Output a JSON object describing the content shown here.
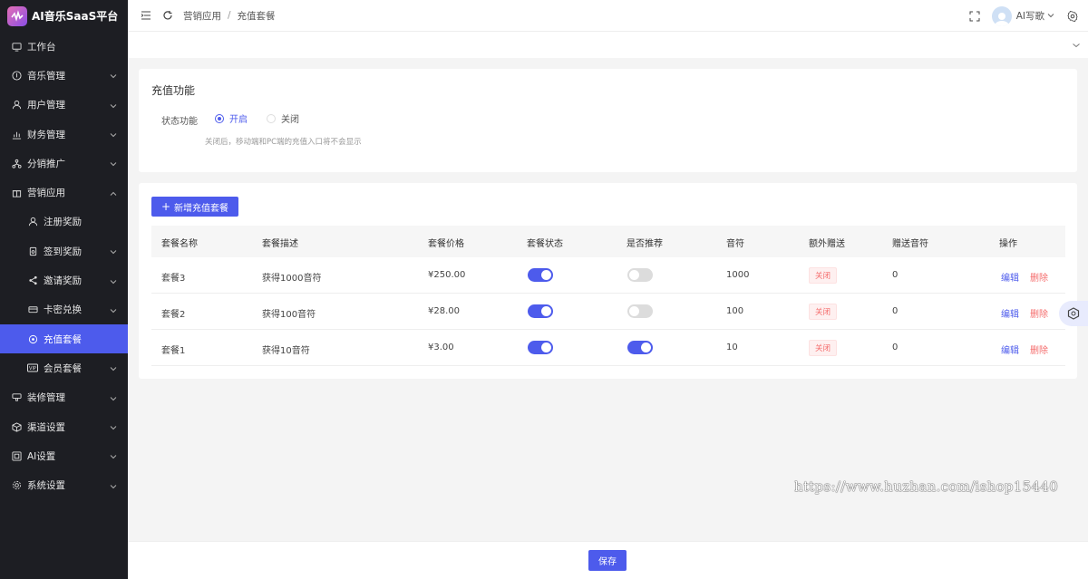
{
  "app": {
    "title": "AI音乐SaaS平台"
  },
  "sidebar": {
    "items": [
      {
        "label": "工作台",
        "icon": "monitor-icon"
      },
      {
        "label": "音乐管理",
        "icon": "music-icon"
      },
      {
        "label": "用户管理",
        "icon": "user-icon"
      },
      {
        "label": "财务管理",
        "icon": "chart-icon"
      },
      {
        "label": "分销推广",
        "icon": "network-icon"
      },
      {
        "label": "营销应用",
        "icon": "gift-icon"
      },
      {
        "label": "注册奖励",
        "icon": "user-icon"
      },
      {
        "label": "签到奖励",
        "icon": "badge-icon"
      },
      {
        "label": "邀请奖励",
        "icon": "share-icon"
      },
      {
        "label": "卡密兑换",
        "icon": "card-icon"
      },
      {
        "label": "充值套餐",
        "icon": "coin-icon"
      },
      {
        "label": "会员套餐",
        "icon": "vip-icon"
      },
      {
        "label": "装修管理",
        "icon": "brush-icon"
      },
      {
        "label": "渠道设置",
        "icon": "cube-icon"
      },
      {
        "label": "AI设置",
        "icon": "ai-icon"
      },
      {
        "label": "系统设置",
        "icon": "gear-icon"
      }
    ]
  },
  "header": {
    "breadcrumb": [
      "营销应用",
      "充值套餐"
    ],
    "breadcrumb_sep": "/",
    "user_name": "AI写歌"
  },
  "settings": {
    "title": "充值功能",
    "field_label": "状态功能",
    "option_on": "开启",
    "option_off": "关闭",
    "hint": "关闭后，移动端和PC端的充值入口将不会显示"
  },
  "table": {
    "add_button": "新增充值套餐",
    "columns": [
      "套餐名称",
      "套餐描述",
      "套餐价格",
      "套餐状态",
      "是否推荐",
      "音符",
      "额外赠送",
      "赠送音符",
      "操作"
    ],
    "rows": [
      {
        "name": "套餐3",
        "desc": "获得1000音符",
        "price": "¥250.00",
        "status": true,
        "recommend": false,
        "notes": "1000",
        "extra": "关闭",
        "gift": "0"
      },
      {
        "name": "套餐2",
        "desc": "获得100音符",
        "price": "¥28.00",
        "status": true,
        "recommend": false,
        "notes": "100",
        "extra": "关闭",
        "gift": "0"
      },
      {
        "name": "套餐1",
        "desc": "获得10音符",
        "price": "¥3.00",
        "status": true,
        "recommend": true,
        "notes": "10",
        "extra": "关闭",
        "gift": "0"
      }
    ],
    "edit_label": "编辑",
    "delete_label": "删除"
  },
  "watermark": "https://www.huzhan.com/ishop15440",
  "footer": {
    "save_label": "保存"
  },
  "colors": {
    "accent": "#4d5bec",
    "sidebar_bg": "#1d1e23",
    "danger": "#f56c6c"
  }
}
